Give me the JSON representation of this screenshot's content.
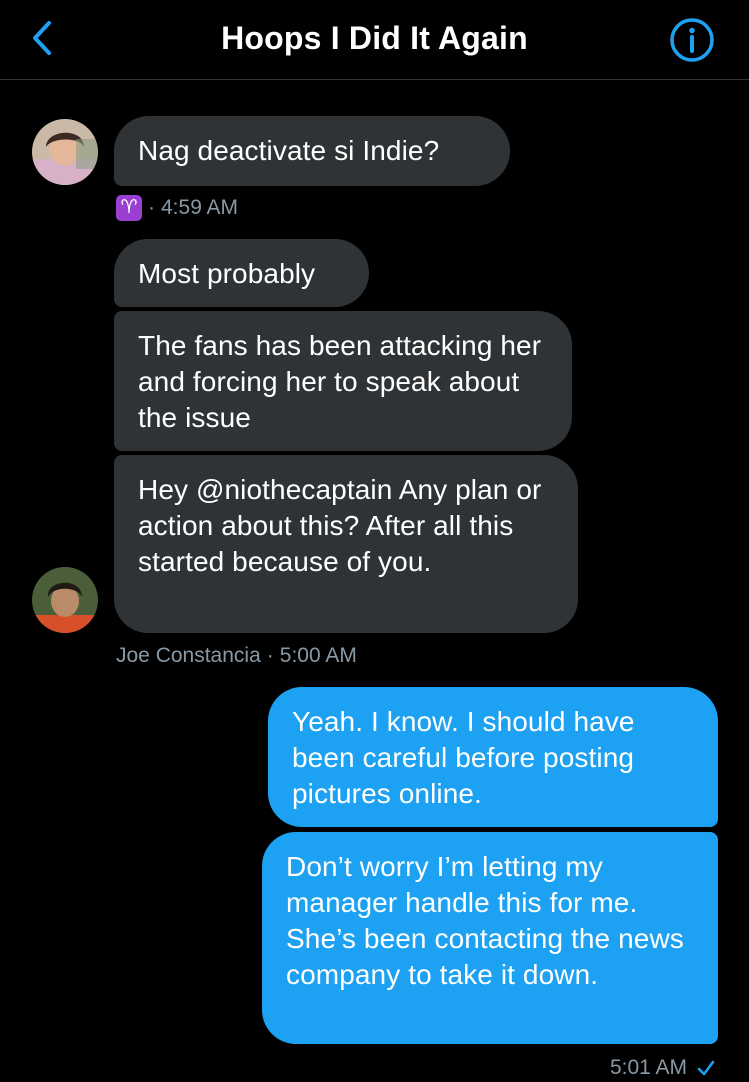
{
  "header": {
    "title": "Hoops I Did It Again"
  },
  "colors": {
    "accent": "#1da1f2",
    "incoming_bubble": "#2f3336",
    "meta_text": "#8899a6",
    "background": "#000000"
  },
  "icons": {
    "back": "chevron-left-icon",
    "info": "info-circle-icon",
    "zodiac": "aries-icon",
    "read": "checkmark-icon"
  },
  "messages": {
    "m1": {
      "text": "Nag deactivate si Indie?"
    },
    "m1_meta": {
      "zodiac": "♈",
      "separator": "·",
      "time": "4:59 AM"
    },
    "m2": {
      "text": "Most probably"
    },
    "m3": {
      "text": "The fans has been attacking her and forcing her to speak about the issue"
    },
    "m4": {
      "text": "Hey @niothecaptain Any plan or action about this? After all this started because of you."
    },
    "m4_meta": {
      "sender": "Joe Constancia",
      "separator": "·",
      "time": "5:00 AM"
    },
    "m5": {
      "text": "Yeah. I know. I should have been careful before posting pictures online."
    },
    "m6": {
      "text": "Don’t worry I’m letting my manager handle this for me. She’s been  contacting the news company to take it down."
    },
    "m6_meta": {
      "time": "5:01 AM"
    }
  }
}
